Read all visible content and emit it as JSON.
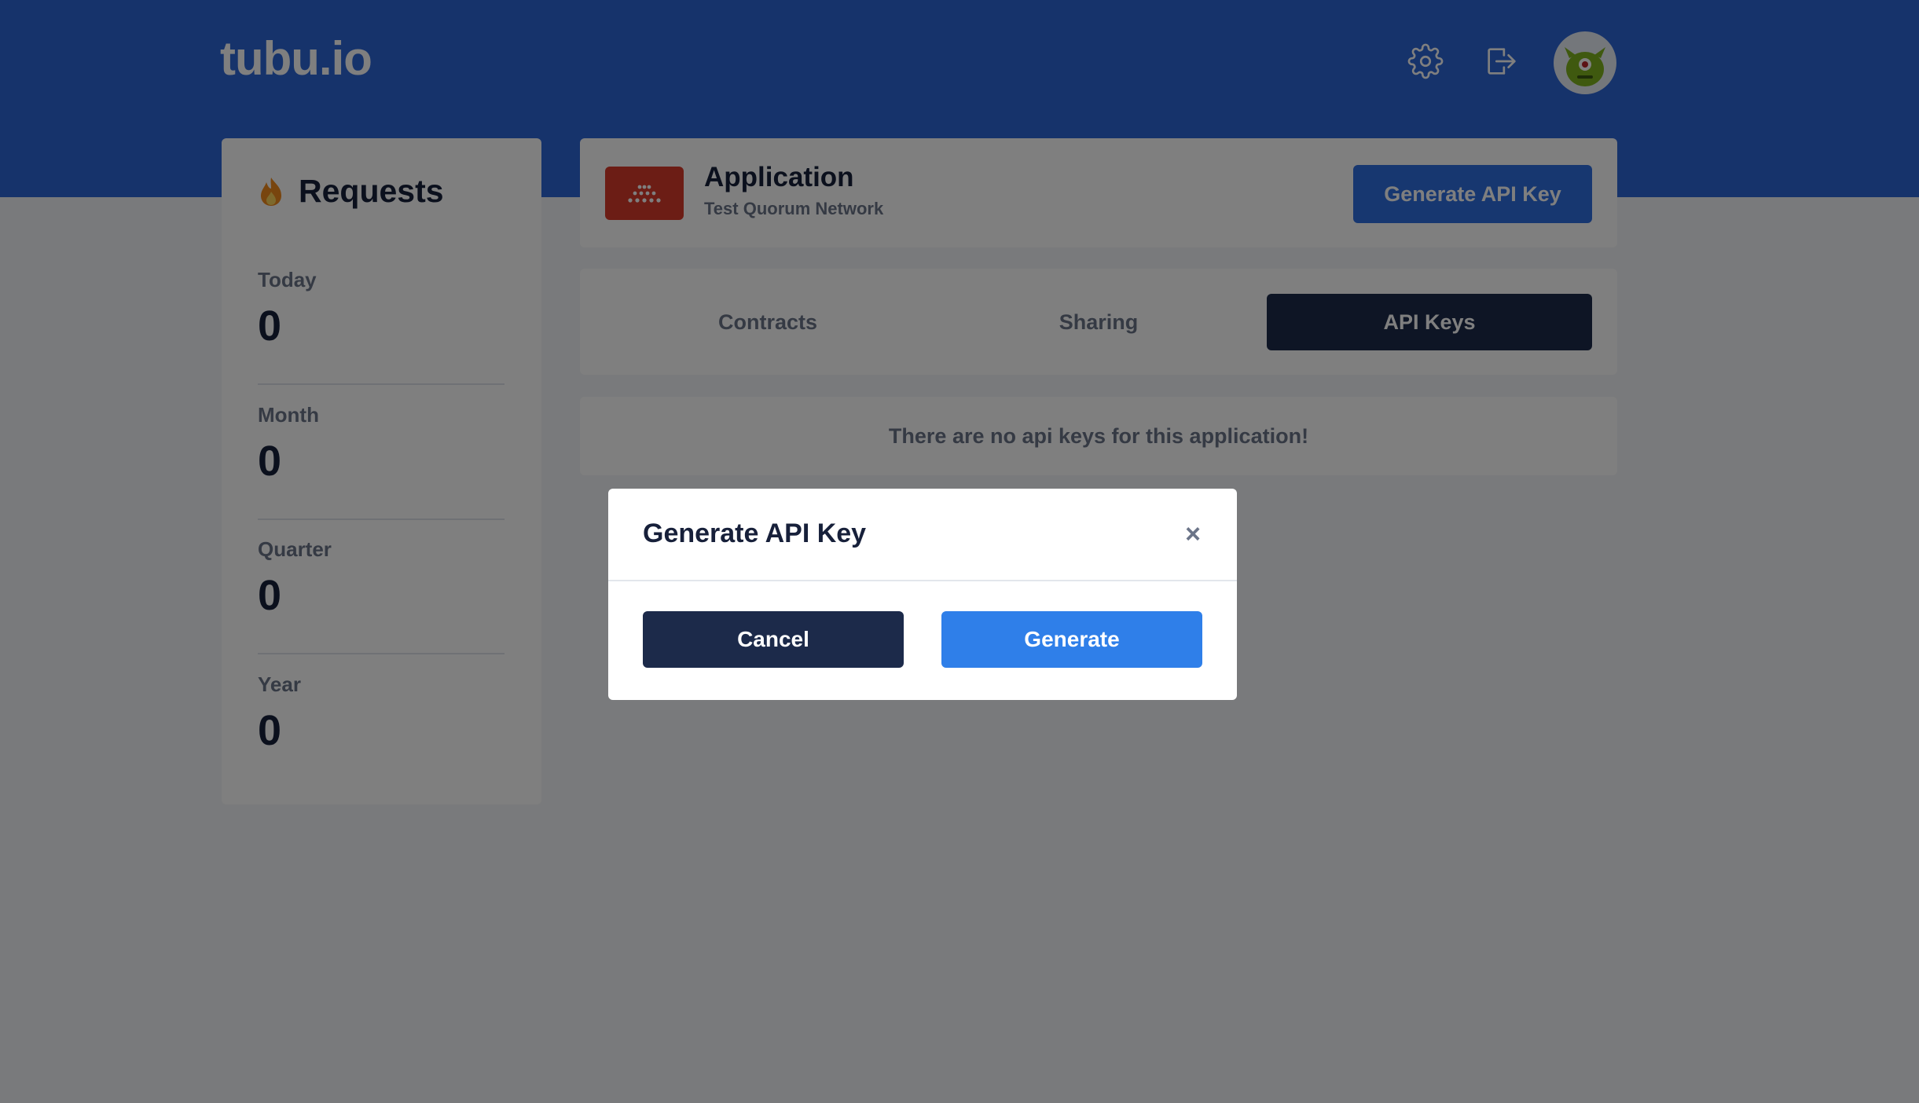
{
  "header": {
    "logo": "tubu.io",
    "settings_icon": "gear-icon",
    "logout_icon": "logout-icon",
    "avatar_icon": "avatar-monster-icon"
  },
  "requests": {
    "title": "Requests",
    "icon": "flame-icon",
    "stats": [
      {
        "label": "Today",
        "value": "0"
      },
      {
        "label": "Month",
        "value": "0"
      },
      {
        "label": "Quarter",
        "value": "0"
      },
      {
        "label": "Year",
        "value": "0"
      }
    ]
  },
  "application": {
    "title": "Application",
    "subtitle": "Test Quorum Network",
    "generate_button": "Generate API Key"
  },
  "tabs": [
    {
      "label": "Contracts",
      "active": false
    },
    {
      "label": "Sharing",
      "active": false
    },
    {
      "label": "API Keys",
      "active": true
    }
  ],
  "empty_message": "There are no api keys for this application!",
  "modal": {
    "title": "Generate API Key",
    "close_symbol": "×",
    "cancel_label": "Cancel",
    "generate_label": "Generate"
  },
  "colors": {
    "header_blue": "#2d66d6",
    "dark_navy": "#1c2a4a",
    "primary_blue": "#2f7fe9",
    "app_thumb_red": "#d93a2b"
  }
}
